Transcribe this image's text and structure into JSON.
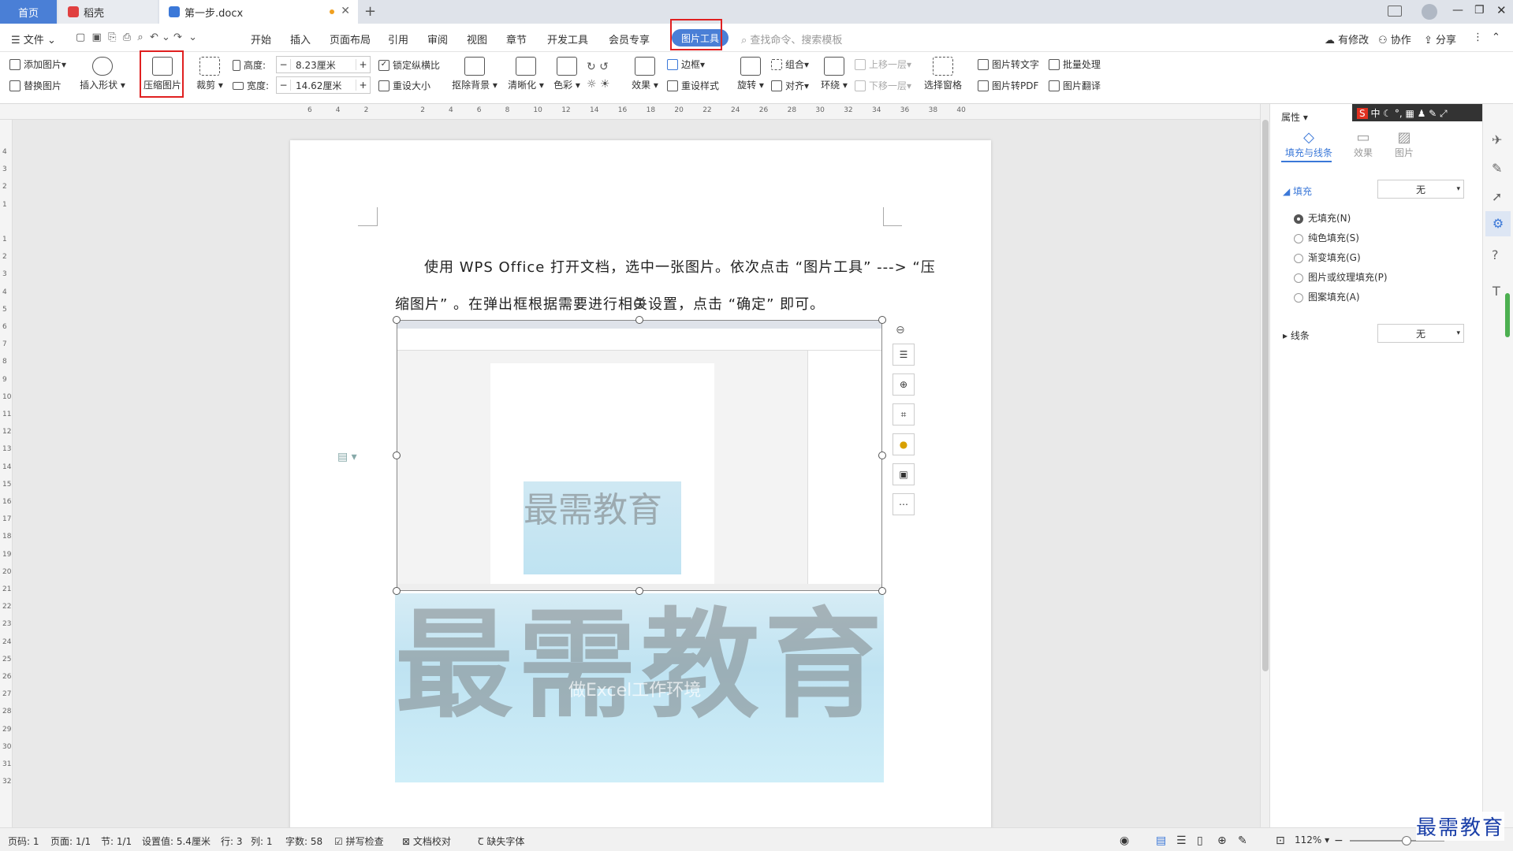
{
  "tabs": {
    "home": "首页",
    "docer": "稻壳",
    "doc": "第一步.docx",
    "add": "+"
  },
  "menu": {
    "file": "文件",
    "items": [
      "开始",
      "插入",
      "页面布局",
      "引用",
      "审阅",
      "视图",
      "章节",
      "开发工具",
      "会员专享"
    ],
    "active": "图片工具",
    "search": "查找命令、搜索模板",
    "right": [
      "有修改",
      "协作",
      "分享"
    ]
  },
  "ribbon": {
    "add_pic": "添加图片",
    "replace_pic": "替换图片",
    "insert_shape": "插入形状",
    "compress_pic": "压缩图片",
    "crop": "裁剪",
    "height_label": "高度:",
    "height_value": "8.23厘米",
    "width_label": "宽度:",
    "width_value": "14.62厘米",
    "lock_ratio": "锁定纵横比",
    "reset_size": "重设大小",
    "cutout": "抠除背景",
    "sharpen": "清晰化",
    "color": "色彩",
    "effect": "效果",
    "border": "边框",
    "reset_style": "重设样式",
    "rotate": "旋转",
    "group": "组合",
    "align": "对齐",
    "wrap": "环绕",
    "up_layer": "上移一层",
    "down_layer": "下移一层",
    "select_pane": "选择窗格",
    "pic_to_text": "图片转文字",
    "batch": "批量处理",
    "pic_to_pdf": "图片转PDF",
    "pic_translate": "图片翻译"
  },
  "ruler_ticks": [
    "6",
    "4",
    "2",
    "",
    "2",
    "4",
    "6",
    "8",
    "10",
    "12",
    "14",
    "16",
    "18",
    "20",
    "22",
    "24",
    "26",
    "28",
    "30",
    "32",
    "34",
    "36",
    "38",
    "40"
  ],
  "vruler_ticks": [
    "4",
    "3",
    "2",
    "1",
    "",
    "1",
    "2",
    "3",
    "4",
    "5",
    "6",
    "7",
    "8",
    "9",
    "10",
    "11",
    "12",
    "13",
    "14",
    "15",
    "16",
    "17",
    "18",
    "19",
    "20",
    "21",
    "22",
    "23",
    "24",
    "25",
    "26",
    "27",
    "28",
    "29",
    "30",
    "31",
    "32"
  ],
  "document": {
    "line1": "使用 WPS Office 打开文档，选中一张图片。依次点击 “图片工具” ---> “压",
    "line2": "缩图片” 。在弹出框根据需要进行相关设置，点击 “确定” 即可。",
    "watermark": "最需教育",
    "bg_caption": "做Excel工作环境"
  },
  "panel": {
    "title": "属性",
    "tabs": [
      "填充与线条",
      "效果",
      "图片"
    ],
    "fill_label": "填充",
    "fill_value": "无",
    "options": [
      "无填充(N)",
      "纯色填充(S)",
      "渐变填充(G)",
      "图片或纹理填充(P)",
      "图案填充(A)"
    ],
    "line_label": "线条",
    "line_value": "无"
  },
  "status": {
    "page": "页码: 1",
    "pages": "页面: 1/1",
    "section": "节: 1/1",
    "setting": "设置值: 5.4厘米",
    "row": "行: 3",
    "col": "列: 1",
    "words": "字数: 58",
    "spell": "拼写检查",
    "proof": "文档校对",
    "missing_font": "缺失字体",
    "zoom": "112%"
  },
  "brand": "最需教育",
  "colors": {
    "accent": "#4a7fd6",
    "highlight": "#e02020"
  }
}
